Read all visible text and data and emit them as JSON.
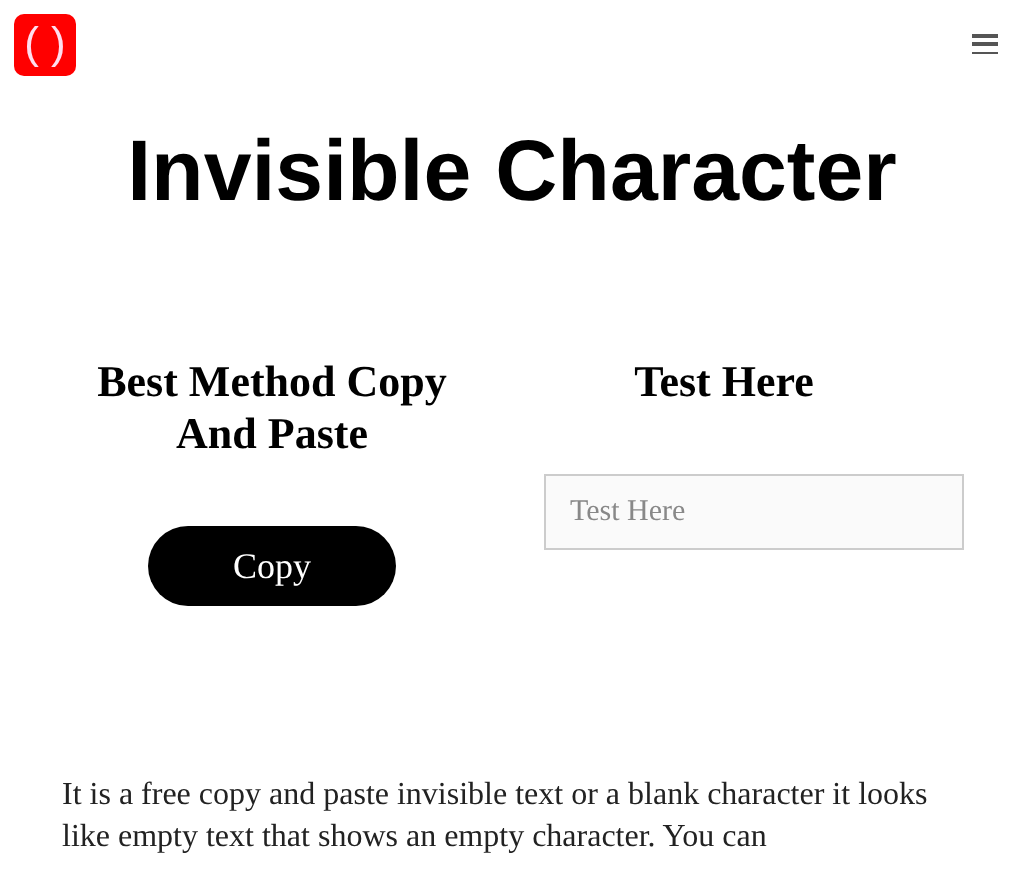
{
  "header": {
    "logo": "( )"
  },
  "title": "Invisible Character",
  "left": {
    "heading": "Best Method Copy And Paste",
    "button": "Copy"
  },
  "right": {
    "heading": "Test Here",
    "placeholder": "Test Here"
  },
  "paragraph": "It is a free copy and paste invisible text or a blank character it looks like empty text that shows an empty character. You can"
}
